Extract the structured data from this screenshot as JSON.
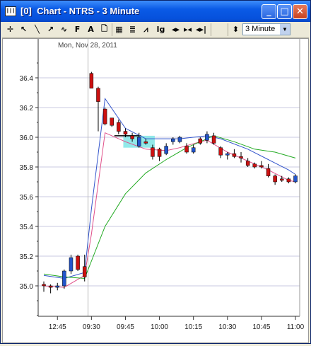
{
  "window": {
    "icon_label": "|||",
    "title": "[0]  Chart - NTRS - 3 Minute",
    "minimize_glyph": "_",
    "maximize_glyph": "□",
    "close_glyph": "✕"
  },
  "toolbar": {
    "buttons": [
      {
        "name": "crosshair-icon",
        "glyph": "✛"
      },
      {
        "name": "pointer-icon",
        "glyph": "↖"
      },
      {
        "name": "line-tool-icon",
        "glyph": "╲"
      },
      {
        "name": "fib-tool-icon",
        "glyph": "↗"
      },
      {
        "name": "wave-tool-icon",
        "glyph": "∿"
      },
      {
        "name": "function-icon",
        "glyph": "F"
      },
      {
        "name": "text-tool-icon",
        "glyph": "A"
      },
      {
        "name": "document-icon",
        "glyph": "🗋"
      },
      {
        "name": "grid-icon",
        "glyph": "▦"
      },
      {
        "name": "bars-icon",
        "glyph": "≣"
      },
      {
        "name": "indicator-icon",
        "glyph": "⩘"
      },
      {
        "name": "log-scale-icon",
        "glyph": "lg"
      },
      {
        "name": "scroll-both-icon",
        "glyph": "◂▸"
      },
      {
        "name": "scroll-in-icon",
        "glyph": "▸◂"
      },
      {
        "name": "scroll-end-icon",
        "glyph": "◂▸|"
      },
      {
        "name": "interval-icon",
        "glyph": "⬍"
      }
    ],
    "interval_value": "3 Minute",
    "interval_arrow": "▼"
  },
  "chart_data": {
    "type": "candlestick",
    "symbol": "NTRS",
    "interval": "3 Minute",
    "date_label": "Mon, Nov 28, 2011",
    "ylim": [
      34.8,
      36.55
    ],
    "y_ticks": [
      35.0,
      35.2,
      35.4,
      35.6,
      35.8,
      36.0,
      36.2,
      36.4
    ],
    "x_ticks": [
      "12:45",
      "09:30",
      "09:45",
      "10:00",
      "10:15",
      "10:30",
      "10:45",
      "11:00"
    ],
    "colors": {
      "up": "#2255cc",
      "down": "#cc1111",
      "grid": "#c8c8e0",
      "ma_blue": "#3355cc",
      "ma_pink": "#e0508a",
      "ma_green": "#22aa22",
      "highlight": "#7fe5e5"
    },
    "candles": [
      {
        "t": "12:39",
        "o": 35.01,
        "h": 35.03,
        "l": 34.96,
        "c": 35.0
      },
      {
        "t": "12:42",
        "o": 35.0,
        "h": 35.01,
        "l": 34.95,
        "c": 34.99
      },
      {
        "t": "12:45",
        "o": 34.99,
        "h": 35.02,
        "l": 34.97,
        "c": 35.0
      },
      {
        "t": "12:48",
        "o": 35.0,
        "h": 35.11,
        "l": 34.98,
        "c": 35.1
      },
      {
        "t": "12:51",
        "o": 35.1,
        "h": 35.21,
        "l": 35.08,
        "c": 35.19
      },
      {
        "t": "12:54",
        "o": 35.2,
        "h": 35.21,
        "l": 35.1,
        "c": 35.11
      },
      {
        "t": "12:57",
        "o": 35.13,
        "h": 35.21,
        "l": 35.03,
        "c": 35.06
      },
      {
        "t": "09:30",
        "o": 36.43,
        "h": 36.44,
        "l": 36.33,
        "c": 36.33
      },
      {
        "t": "09:33",
        "o": 36.33,
        "h": 36.34,
        "l": 36.04,
        "c": 36.24
      },
      {
        "t": "09:36",
        "o": 36.19,
        "h": 36.2,
        "l": 36.08,
        "c": 36.09
      },
      {
        "t": "09:39",
        "o": 36.13,
        "h": 36.13,
        "l": 36.07,
        "c": 36.08
      },
      {
        "t": "09:42",
        "o": 36.1,
        "h": 36.12,
        "l": 36.02,
        "c": 36.04
      },
      {
        "t": "09:45",
        "o": 36.04,
        "h": 36.06,
        "l": 36.0,
        "c": 36.02
      },
      {
        "t": "09:48",
        "o": 36.01,
        "h": 36.03,
        "l": 35.97,
        "c": 35.99
      },
      {
        "t": "09:51",
        "o": 35.94,
        "h": 36.03,
        "l": 35.93,
        "c": 36.0
      },
      {
        "t": "09:54",
        "o": 35.97,
        "h": 35.99,
        "l": 35.95,
        "c": 35.96
      },
      {
        "t": "09:57",
        "o": 35.93,
        "h": 35.95,
        "l": 35.85,
        "c": 35.87
      },
      {
        "t": "10:00",
        "o": 35.92,
        "h": 35.93,
        "l": 35.84,
        "c": 35.87
      },
      {
        "t": "10:03",
        "o": 35.89,
        "h": 35.96,
        "l": 35.88,
        "c": 35.94
      },
      {
        "t": "10:06",
        "o": 35.97,
        "h": 36.0,
        "l": 35.95,
        "c": 35.99
      },
      {
        "t": "10:09",
        "o": 35.97,
        "h": 36.01,
        "l": 35.96,
        "c": 36.0
      },
      {
        "t": "10:12",
        "o": 35.94,
        "h": 35.96,
        "l": 35.89,
        "c": 35.9
      },
      {
        "t": "10:15",
        "o": 35.9,
        "h": 35.95,
        "l": 35.89,
        "c": 35.93
      },
      {
        "t": "10:18",
        "o": 35.99,
        "h": 36.0,
        "l": 35.95,
        "c": 35.96
      },
      {
        "t": "10:21",
        "o": 35.98,
        "h": 36.04,
        "l": 35.96,
        "c": 36.02
      },
      {
        "t": "10:24",
        "o": 36.01,
        "h": 36.03,
        "l": 35.95,
        "c": 35.96
      },
      {
        "t": "10:27",
        "o": 35.93,
        "h": 35.94,
        "l": 35.86,
        "c": 35.88
      },
      {
        "t": "10:30",
        "o": 35.88,
        "h": 35.9,
        "l": 35.85,
        "c": 35.89
      },
      {
        "t": "10:33",
        "o": 35.89,
        "h": 35.92,
        "l": 35.86,
        "c": 35.87
      },
      {
        "t": "10:36",
        "o": 35.87,
        "h": 35.9,
        "l": 35.83,
        "c": 35.86
      },
      {
        "t": "10:39",
        "o": 35.84,
        "h": 35.86,
        "l": 35.8,
        "c": 35.81
      },
      {
        "t": "10:42",
        "o": 35.82,
        "h": 35.83,
        "l": 35.79,
        "c": 35.8
      },
      {
        "t": "10:45",
        "o": 35.81,
        "h": 35.84,
        "l": 35.79,
        "c": 35.8
      },
      {
        "t": "10:48",
        "o": 35.79,
        "h": 35.82,
        "l": 35.73,
        "c": 35.74
      },
      {
        "t": "10:51",
        "o": 35.74,
        "h": 35.75,
        "l": 35.68,
        "c": 35.7
      },
      {
        "t": "10:54",
        "o": 35.72,
        "h": 35.74,
        "l": 35.7,
        "c": 35.71
      },
      {
        "t": "10:57",
        "o": 35.72,
        "h": 35.73,
        "l": 35.69,
        "c": 35.7
      },
      {
        "t": "11:00",
        "o": 35.7,
        "h": 35.75,
        "l": 35.69,
        "c": 35.74
      }
    ],
    "lines": [
      {
        "color": "#3355cc",
        "points": [
          [
            0,
            35.07
          ],
          [
            3,
            35.05
          ],
          [
            6,
            35.09
          ],
          [
            7,
            35.52
          ],
          [
            9,
            36.26
          ],
          [
            12,
            36.06
          ],
          [
            15,
            35.99
          ],
          [
            20,
            35.99
          ],
          [
            24,
            36.01
          ],
          [
            26,
            35.99
          ],
          [
            30,
            35.92
          ],
          [
            33,
            35.85
          ],
          [
            36,
            35.78
          ],
          [
            37,
            35.75
          ]
        ]
      },
      {
        "color": "#e0508a",
        "points": [
          [
            0,
            35.0
          ],
          [
            3,
            34.99
          ],
          [
            6,
            35.07
          ],
          [
            7,
            35.35
          ],
          [
            9,
            36.03
          ],
          [
            12,
            35.97
          ],
          [
            15,
            35.92
          ],
          [
            18,
            35.91
          ],
          [
            20,
            35.93
          ],
          [
            23,
            35.97
          ],
          [
            24,
            35.98
          ],
          [
            27,
            35.9
          ],
          [
            30,
            35.84
          ],
          [
            33,
            35.78
          ],
          [
            36,
            35.71
          ],
          [
            37,
            35.7
          ]
        ]
      },
      {
        "color": "#22aa22",
        "points": [
          [
            0,
            35.08
          ],
          [
            3,
            35.06
          ],
          [
            6,
            35.05
          ],
          [
            9,
            35.4
          ],
          [
            12,
            35.62
          ],
          [
            15,
            35.76
          ],
          [
            18,
            35.85
          ],
          [
            21,
            35.93
          ],
          [
            24,
            35.99
          ],
          [
            25,
            36.01
          ],
          [
            28,
            35.97
          ],
          [
            31,
            35.92
          ],
          [
            34,
            35.9
          ],
          [
            37,
            35.86
          ]
        ]
      }
    ],
    "highlight_box": {
      "x_from": 12,
      "x_to": 16,
      "y_from": 35.93,
      "y_to": 36.01
    }
  }
}
